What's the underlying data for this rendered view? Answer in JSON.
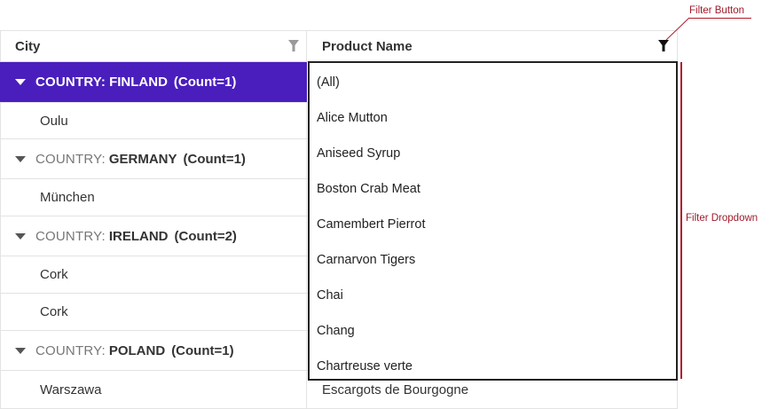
{
  "columns": {
    "city": "City",
    "product": "Product Name"
  },
  "rows": [
    {
      "type": "group",
      "prefix": "COUNTRY:",
      "value": "FINLAND",
      "count": "(Count=1)",
      "selected": true
    },
    {
      "type": "data",
      "city": "Oulu",
      "product": ""
    },
    {
      "type": "group",
      "prefix": "COUNTRY:",
      "value": "GERMANY",
      "count": "(Count=1)",
      "selected": false
    },
    {
      "type": "data",
      "city": "München",
      "product": ""
    },
    {
      "type": "group",
      "prefix": "COUNTRY:",
      "value": "IRELAND",
      "count": "(Count=2)",
      "selected": false
    },
    {
      "type": "data",
      "city": "Cork",
      "product": ""
    },
    {
      "type": "data",
      "city": "Cork",
      "product": ""
    },
    {
      "type": "group",
      "prefix": "COUNTRY:",
      "value": "POLAND",
      "count": "(Count=1)",
      "selected": false
    },
    {
      "type": "data",
      "city": "Warszawa",
      "product": "Escargots de Bourgogne"
    }
  ],
  "filter_dropdown": {
    "items": [
      "(All)",
      "Alice Mutton",
      "Aniseed Syrup",
      "Boston Crab Meat",
      "Camembert Pierrot",
      "Carnarvon Tigers",
      "Chai",
      "Chang",
      "Chartreuse verte"
    ]
  },
  "annotations": {
    "filter_button": "Filter Button",
    "filter_dropdown": "Filter Dropdown"
  },
  "colors": {
    "selected_group_bg": "#4a1ebd",
    "annotation": "#b01a2a"
  },
  "icons": {
    "column_filter": "filter-funnel-icon",
    "group_toggle": "caret-down-icon"
  }
}
